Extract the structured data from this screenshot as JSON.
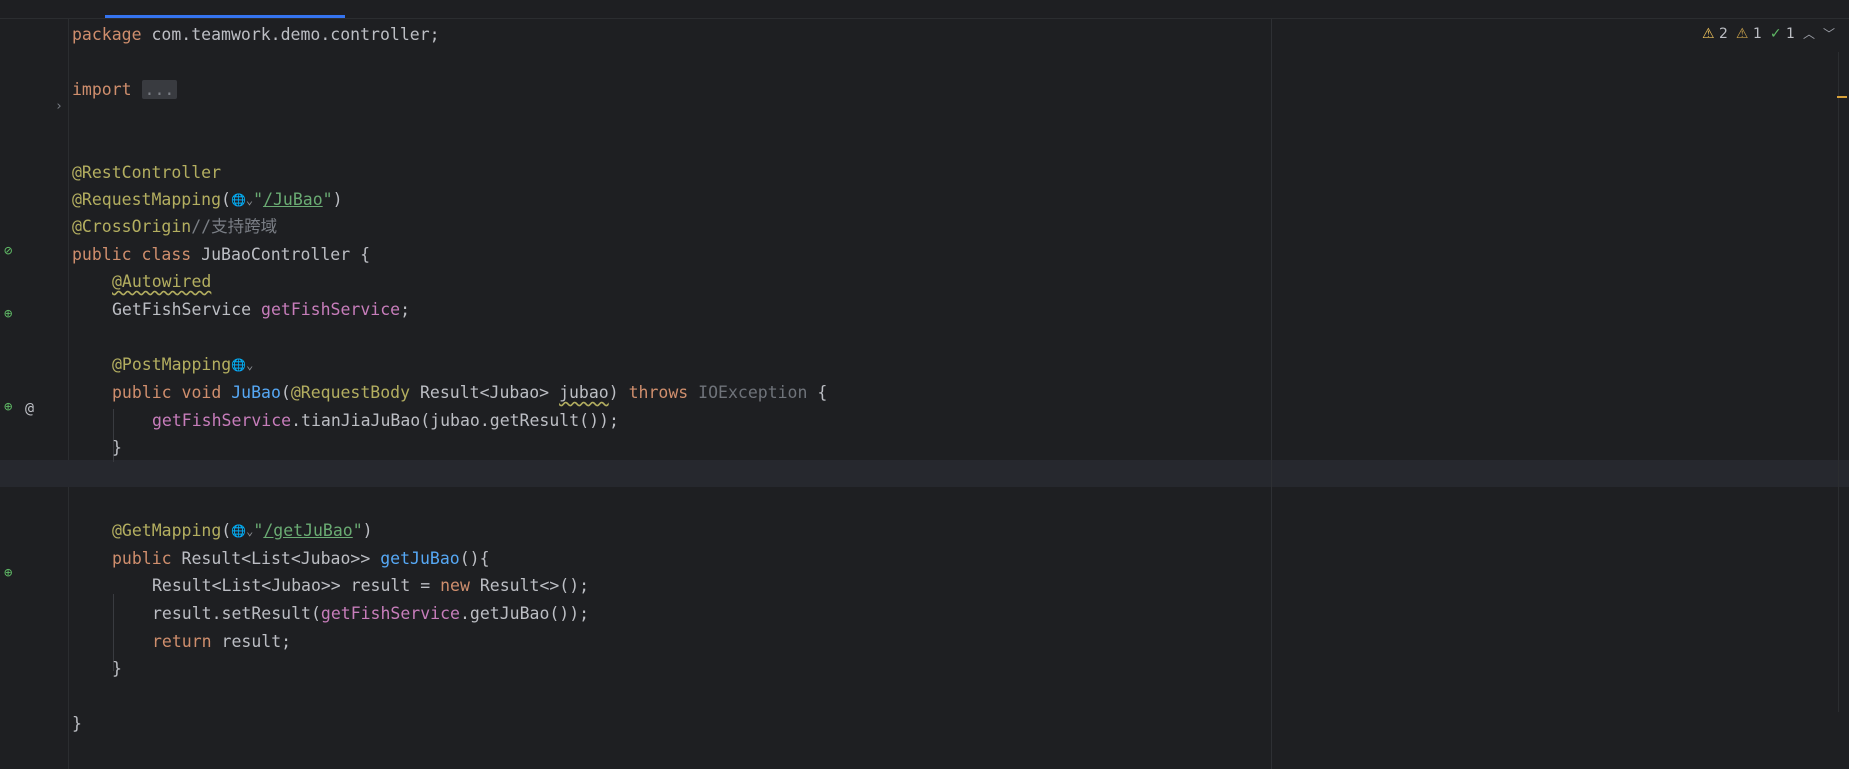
{
  "colors": {
    "background": "#1e1f22",
    "keyword": "#cf8e6d",
    "annotation": "#b3ae60",
    "string": "#6aab73",
    "field": "#c77dbb",
    "method": "#56a8f5",
    "comment": "#7a7e85",
    "accent_tab": "#3574f0"
  },
  "inspections": {
    "warnings": "2",
    "weak_warnings": "1",
    "typos": "1"
  },
  "code": {
    "l1": {
      "kw": "package",
      "rest": " com.teamwork.demo.controller;"
    },
    "l3": {
      "kw": "import",
      "fold": "..."
    },
    "l6": {
      "ann": "@RestController"
    },
    "l7": {
      "ann": "@RequestMapping",
      "open": "(",
      "globe": "🌐⌄",
      "q1": "\"",
      "path": "/JuBao",
      "q2": "\"",
      "close": ")"
    },
    "l8": {
      "ann": "@CrossOrigin",
      "comment": "//支持跨域"
    },
    "l9": {
      "kw": "public class",
      "rest": " JuBaoController {"
    },
    "l10": {
      "ann": "@Autowired"
    },
    "l11": {
      "type": "GetFishService ",
      "field": "getFishService",
      "semi": ";"
    },
    "l13": {
      "ann": "@PostMapping",
      "globe": "🌐⌄"
    },
    "l14": {
      "kw": "public void ",
      "fn": "JuBao",
      "open": "(",
      "ann": "@RequestBody",
      "type": " Result<Jubao> ",
      "param": "jubao",
      "close": ") ",
      "throws": "throws",
      "exc": " IOException",
      "brace": " {"
    },
    "l15": {
      "field": "getFishService",
      "rest": ".tianJiaJuBao(jubao.getResult());"
    },
    "l16": {
      "brace": "}"
    },
    "l19": {
      "ann": "@GetMapping",
      "open": "(",
      "globe": "🌐⌄",
      "q1": "\"",
      "path": "/getJuBao",
      "q2": "\"",
      "close": ")"
    },
    "l20": {
      "kw": "public ",
      "type": "Result<List<Jubao>> ",
      "fn": "getJuBao",
      "rest": "(){"
    },
    "l21": {
      "type": "Result<List<Jubao>> result = ",
      "kw": "new",
      "rest": " Result<>();"
    },
    "l22": {
      "pre": "result.setResult(",
      "field": "getFishService",
      "rest": ".getJuBao());"
    },
    "l23": {
      "kw": "return",
      "rest": " result;"
    },
    "l24": {
      "brace": "}"
    },
    "l26": {
      "brace": "}"
    }
  },
  "icons": {
    "gutter": [
      "bean-no-autowire-icon",
      "bean-autowired-icon",
      "web-endpoint-icon",
      "at-sign-icon",
      "web-endpoint-icon"
    ],
    "fold": "chevron-right-icon"
  }
}
